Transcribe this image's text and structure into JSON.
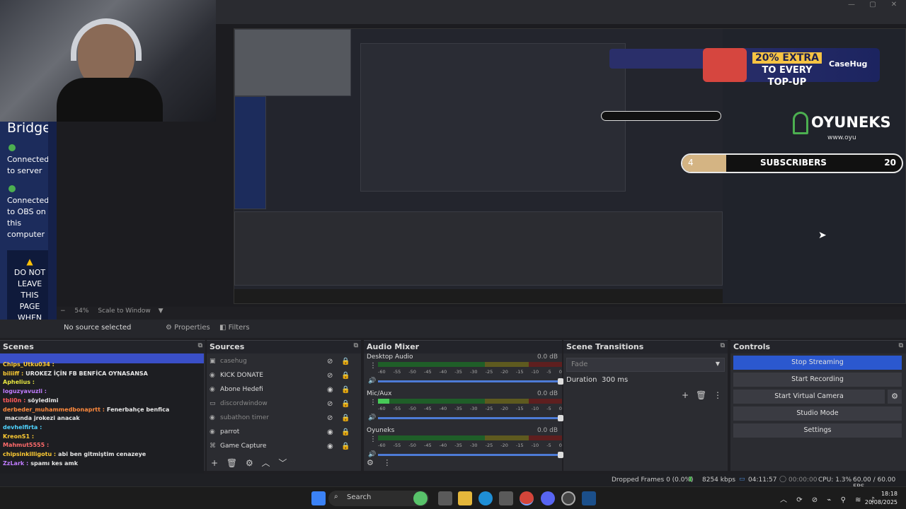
{
  "bridge": {
    "title": "Bridge",
    "status1": "Connected to server",
    "status2": "Connected to OBS on this computer",
    "warning": "DO NOT LEAVE THIS PAGE WHEN"
  },
  "overlay": {
    "promo_prefix": "20% EXTRA",
    "promo_text": "TO EVERY TOP-UP",
    "promo_brand": "CaseHug",
    "logo": "OYUNEKS",
    "logo_sub": "www.oyu",
    "sub_count": "4",
    "sub_label": "SUBSCRIBERS",
    "sub_goal": "20",
    "sub_progress": 0.2
  },
  "preview": {
    "zoom": "54%",
    "scale_mode": "Scale to Window"
  },
  "context": {
    "no_source": "No source selected",
    "properties": "Properties",
    "filters": "Filters"
  },
  "docks": {
    "scenes": "Scenes",
    "sources": "Sources",
    "mixer": "Audio Mixer",
    "transitions": "Scene Transitions",
    "controls": "Controls"
  },
  "chat": [
    {
      "user": "Chips_Utku034 :",
      "msg": "",
      "color": "#ffcc33"
    },
    {
      "user": "biliiff :",
      "msg": "UROKEZ İÇİN FB BENFİCA OYNASANSA",
      "color": "#ffcc33"
    },
    {
      "user": "Aphelius :",
      "msg": "",
      "color": "#e8e840"
    },
    {
      "user": "loguzyavuzli :",
      "msg": "",
      "color": "#c07cff"
    },
    {
      "user": "tbli0n :",
      "msg": "söyledimi",
      "color": "#ff5a5a"
    },
    {
      "user": "derbeder_muhammedbonaprtt :",
      "msg": "Fenerbahçe benfica",
      "color": "#ff8a3d"
    },
    {
      "user": "",
      "msg": "macında jrokezi anacak",
      "color": "#ffffff"
    },
    {
      "user": "devhelfirta :",
      "msg": "",
      "color": "#4fd4ff"
    },
    {
      "user": "KreonS1 :",
      "msg": "",
      "color": "#ffcc33"
    },
    {
      "user": "Mahmut5555 :",
      "msg": "",
      "color": "#ff6b6b"
    },
    {
      "user": "chipsinkilligotu :",
      "msg": "abi ben gitmiştim cenazeye",
      "color": "#ffcc33"
    },
    {
      "user": "ZzLark :",
      "msg": "spamı kes amk",
      "color": "#c07cff"
    }
  ],
  "sources": [
    {
      "name": "casehug",
      "icon": "image-icon",
      "visible": false,
      "dim": true
    },
    {
      "name": "KICK DONATE",
      "icon": "browser-icon",
      "visible": false,
      "dim": false
    },
    {
      "name": "Abone Hedefi",
      "icon": "browser-icon",
      "visible": true,
      "dim": false
    },
    {
      "name": "discordwindow",
      "icon": "window-icon",
      "visible": false,
      "dim": true
    },
    {
      "name": "subathon timer",
      "icon": "browser-icon",
      "visible": false,
      "dim": true
    },
    {
      "name": "parrot",
      "icon": "browser-icon",
      "visible": true,
      "dim": false
    },
    {
      "name": "Game Capture",
      "icon": "gamepad-icon",
      "visible": true,
      "dim": false
    }
  ],
  "mixer": [
    {
      "name": "Desktop Audio",
      "db": "0.0 dB",
      "level": 0.0
    },
    {
      "name": "Mic/Aux",
      "db": "0.0 dB",
      "level": 0.06
    },
    {
      "name": "Oyuneks",
      "db": "0.0 dB",
      "level": 0.0
    }
  ],
  "mixer_scale": [
    "-60",
    "-55",
    "-50",
    "-45",
    "-40",
    "-35",
    "-30",
    "-25",
    "-20",
    "-15",
    "-10",
    "-5",
    "0"
  ],
  "transitions": {
    "type": "Fade",
    "duration_label": "Duration",
    "duration": "300 ms"
  },
  "controls": {
    "stop_streaming": "Stop Streaming",
    "start_recording": "Start Recording",
    "start_virtual_camera": "Start Virtual Camera",
    "studio_mode": "Studio Mode",
    "settings": "Settings"
  },
  "status": {
    "dropped": "Dropped Frames 0 (0.0%)",
    "bitrate": "8254 kbps",
    "live_time": "04:11:57",
    "rec_time": "00:00:00",
    "cpu": "CPU: 1.3%",
    "fps": "60.00 / 60.00 FPS"
  },
  "taskbar": {
    "search": "Search",
    "time": "18:18",
    "date": "20/08/2025"
  },
  "colors": {
    "accent": "#2b58cf",
    "bridge_bg": "#1c2c5c"
  }
}
